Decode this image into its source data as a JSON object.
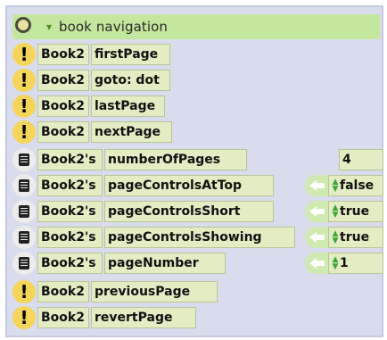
{
  "header": {
    "title": "book navigation",
    "expander_icon": "triangle-down-icon",
    "menu_icon": "circle-menu-icon"
  },
  "rows": [
    {
      "kind": "command",
      "icon": "exclamation-icon",
      "receiver": "Book2",
      "selector": "firstPage"
    },
    {
      "kind": "command",
      "icon": "exclamation-icon",
      "receiver": "Book2",
      "selector": "goto: dot"
    },
    {
      "kind": "command",
      "icon": "exclamation-icon",
      "receiver": "Book2",
      "selector": "lastPage"
    },
    {
      "kind": "command",
      "icon": "exclamation-icon",
      "receiver": "Book2",
      "selector": "nextPage"
    },
    {
      "kind": "getter",
      "icon": "document-icon",
      "receiver": "Book2's",
      "selector": "numberOfPages",
      "value": "4"
    },
    {
      "kind": "getter",
      "icon": "document-icon",
      "receiver": "Book2's",
      "selector": "pageControlsAtTop",
      "value": "false"
    },
    {
      "kind": "getter",
      "icon": "document-icon",
      "receiver": "Book2's",
      "selector": "pageControlsShort",
      "value": "true"
    },
    {
      "kind": "getter",
      "icon": "document-icon",
      "receiver": "Book2's",
      "selector": "pageControlsShowing",
      "value": "true"
    },
    {
      "kind": "getter",
      "icon": "document-icon",
      "receiver": "Book2's",
      "selector": "pageNumber",
      "value": "1"
    },
    {
      "kind": "command",
      "icon": "exclamation-icon",
      "receiver": "Book2",
      "selector": "previousPage"
    },
    {
      "kind": "command",
      "icon": "exclamation-icon",
      "receiver": "Book2",
      "selector": "revertPage"
    }
  ],
  "colors": {
    "header_bg": "#c2e79d",
    "cell_bg": "#e4ecc4",
    "bang_bg": "#f5d65a",
    "panel_bg": "#d9dcec"
  }
}
